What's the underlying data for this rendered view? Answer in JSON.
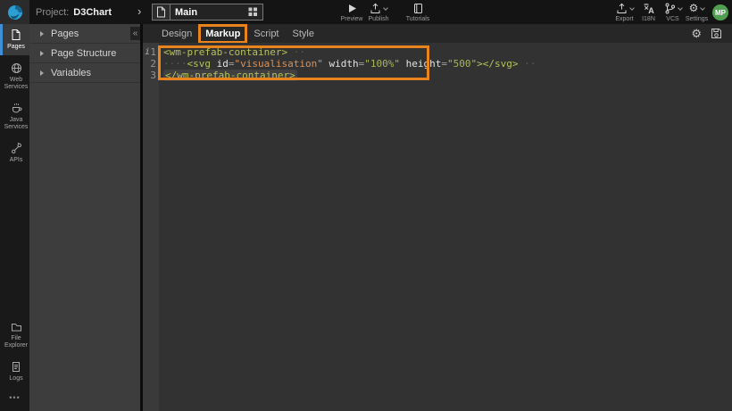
{
  "topbar": {
    "project_label": "Project:",
    "project_name": "D3Chart",
    "chevron": "›",
    "page_tab": {
      "name": "Main"
    },
    "preview_label": "Preview",
    "publish_label": "Publish",
    "tutorials_label": "Tutorials",
    "export_label": "Export",
    "i18n_label": "I18N",
    "vcs_label": "VCS",
    "settings_label": "Settings",
    "settings_glyph": "⚙",
    "avatar_initials": "MP"
  },
  "rail": {
    "items": [
      {
        "label": "Pages",
        "active": true
      },
      {
        "label": "Web Services"
      },
      {
        "label": "Java Services"
      },
      {
        "label": "APIs"
      },
      {
        "label": "File Explorer"
      },
      {
        "label": "Logs"
      }
    ],
    "more": "•••"
  },
  "panel": {
    "collapse": "«",
    "items": [
      {
        "label": "Pages"
      },
      {
        "label": "Page Structure"
      },
      {
        "label": "Variables"
      }
    ]
  },
  "tabbar": {
    "tabs": [
      {
        "label": "Design"
      },
      {
        "label": "Markup",
        "active": true
      },
      {
        "label": "Script"
      },
      {
        "label": "Style"
      }
    ],
    "gear_glyph": "⚙"
  },
  "editor": {
    "lines": [
      {
        "num": "1",
        "marker": "i",
        "tokens": [
          [
            "t",
            "<wm-prefab-container>"
          ],
          [
            "ws",
            " ··"
          ]
        ]
      },
      {
        "num": "2",
        "tokens": [
          [
            "ws",
            "····"
          ],
          [
            "t",
            "<svg"
          ],
          [
            "p",
            " "
          ],
          [
            "a",
            "id"
          ],
          [
            "eq",
            "="
          ],
          [
            "so",
            "\"visualisation\""
          ],
          [
            "p",
            " "
          ],
          [
            "a",
            "width"
          ],
          [
            "eq",
            "="
          ],
          [
            "sg",
            "\"100%\""
          ],
          [
            "p",
            " "
          ],
          [
            "a",
            "height"
          ],
          [
            "eq",
            "="
          ],
          [
            "sg",
            "\"500\""
          ],
          [
            "t",
            "></svg>"
          ],
          [
            "ws",
            " ··"
          ]
        ]
      },
      {
        "num": "3",
        "tokens": [
          [
            "tm",
            "</wm-prefab-container>"
          ]
        ]
      }
    ]
  },
  "colors": {
    "annotation_orange": "#e8831d",
    "brand_blue": "#2e9fd4",
    "active_item_blue": "#3f8fd6",
    "avatar_green": "#4f9e51",
    "code_tag": "#b6c25a",
    "code_string_orange": "#d9925c",
    "code_string_green": "#a9b65a"
  }
}
